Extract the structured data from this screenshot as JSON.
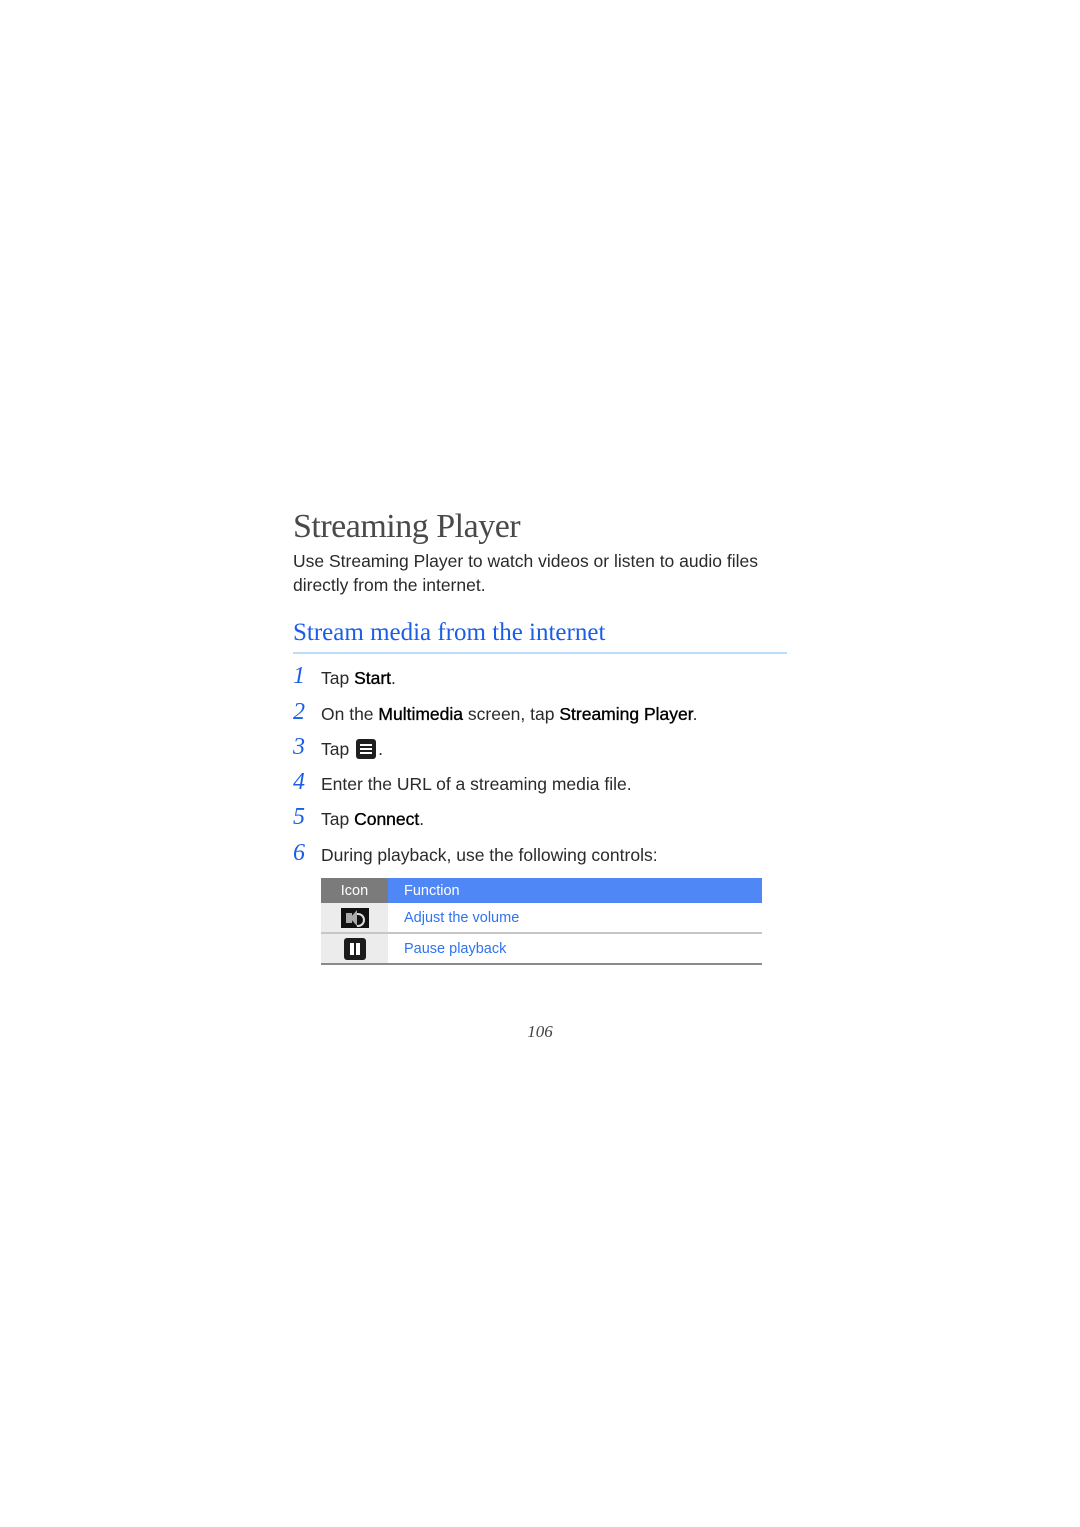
{
  "document": {
    "title": "Streaming Player",
    "intro": "Use Streaming Player to watch videos or listen to audio files directly from the internet.",
    "section_title": "Stream media from the internet",
    "steps": [
      {
        "num": "1",
        "pre": "Tap ",
        "bold": "Start",
        "post": "."
      },
      {
        "num": "2",
        "pre": "On the ",
        "bold": "Multimedia",
        "mid": " screen, tap ",
        "bold2": "Streaming Player",
        "post": "."
      },
      {
        "num": "3",
        "pre": "Tap ",
        "icon": "menu-list-icon",
        "post": "."
      },
      {
        "num": "4",
        "text": "Enter the URL of a streaming media file."
      },
      {
        "num": "5",
        "pre": "Tap ",
        "bold": "Connect",
        "post": "."
      },
      {
        "num": "6",
        "text": "During playback, use the following controls:"
      }
    ],
    "table": {
      "headers": {
        "icon": "Icon",
        "function": "Function"
      },
      "rows": [
        {
          "icon": "volume-icon",
          "function": "Adjust the volume"
        },
        {
          "icon": "pause-icon",
          "function": "Pause playback"
        }
      ]
    },
    "page_number": "106"
  },
  "colors": {
    "accent_blue": "#1a5ee8",
    "table_header_blue": "#4f87f7",
    "table_header_grey": "#7b7b7b",
    "link_blue": "#2f73ef"
  }
}
